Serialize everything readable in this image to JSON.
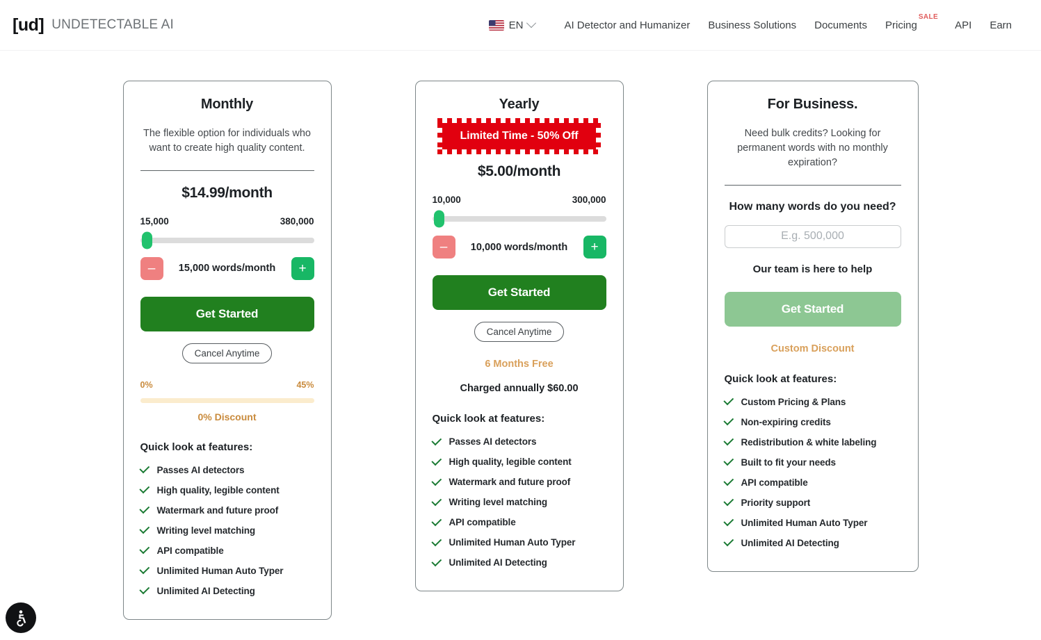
{
  "header": {
    "logo_mark": "[ud]",
    "logo_name": "UNDETECTABLE AI",
    "language": {
      "code": "EN",
      "flag": "us-flag-icon"
    },
    "nav": [
      {
        "label": "AI Detector and Humanizer"
      },
      {
        "label": "Business Solutions"
      },
      {
        "label": "Documents"
      },
      {
        "label": "Pricing",
        "badge": "SALE"
      },
      {
        "label": "API"
      },
      {
        "label": "Earn"
      }
    ]
  },
  "plans": {
    "monthly": {
      "title": "Monthly",
      "description": "The flexible option for individuals who want to create high quality content.",
      "price": "$14.99/month",
      "range_min": "15,000",
      "range_max": "380,000",
      "slider_percent": 0,
      "words_value": "15,000 words/month",
      "minus": "–",
      "plus": "+",
      "cta": "Get Started",
      "cancel": "Cancel Anytime",
      "discount_min": "0%",
      "discount_max": "45%",
      "discount_text": "0% Discount",
      "features_title": "Quick look at features:",
      "features": [
        "Passes AI detectors",
        "High quality, legible content",
        "Watermark and future proof",
        "Writing level matching",
        "API compatible",
        "Unlimited Human Auto Typer",
        "Unlimited AI Detecting"
      ]
    },
    "yearly": {
      "title": "Yearly",
      "badge": "Limited Time - 50% Off",
      "price": "$5.00/month",
      "range_min": "10,000",
      "range_max": "300,000",
      "slider_percent": 0,
      "words_value": "10,000 words/month",
      "minus": "–",
      "plus": "+",
      "cta": "Get Started",
      "cancel": "Cancel Anytime",
      "months_free": "6 Months Free",
      "charged": "Charged annually $60.00",
      "features_title": "Quick look at features:",
      "features": [
        "Passes AI detectors",
        "High quality, legible content",
        "Watermark and future proof",
        "Writing level matching",
        "API compatible",
        "Unlimited Human Auto Typer",
        "Unlimited AI Detecting"
      ]
    },
    "business": {
      "title": "For Business.",
      "description": "Need bulk credits? Looking for permanent words with no monthly expiration?",
      "question": "How many words do you need?",
      "input_placeholder": "E.g. 500,000",
      "input_value": "",
      "help": "Our team is here to help",
      "cta": "Get Started",
      "custom_discount": "Custom Discount",
      "features_title": "Quick look at features:",
      "features": [
        "Custom Pricing & Plans",
        "Non-expiring credits",
        "Redistribution & white labeling",
        "Built to fit your needs",
        "API compatible",
        "Priority support",
        "Unlimited Human Auto Typer",
        "Unlimited AI Detecting"
      ]
    }
  },
  "accessibility_widget": {
    "icon": "wheelchair-accessibility-icon"
  },
  "colors": {
    "cta_green": "#21801f",
    "cta_green_muted": "#8dc793",
    "badge_red": "#e1000f",
    "sale_red": "#e05c5c",
    "gold": "#c98b3d",
    "gold_light": "#d9a05b",
    "slider_thumb_green": "#21c26d",
    "plus_green": "#18b765",
    "minus_salmon": "#ef8080",
    "card_border": "#7d8688",
    "discount_bar": "#fbeccd"
  }
}
